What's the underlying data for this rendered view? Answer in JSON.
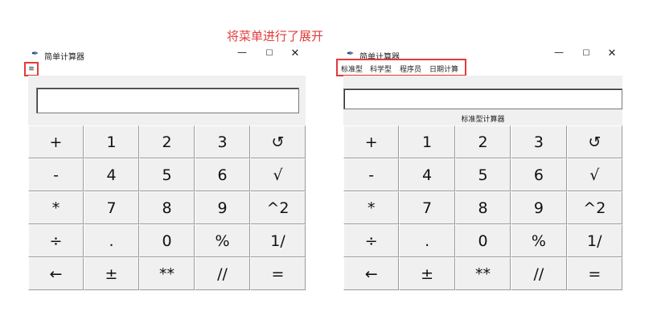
{
  "annotation": "将菜单进行了展开",
  "left_window": {
    "title": "简单计算器",
    "menu_toggle_label": "≡",
    "display_value": "",
    "keys": [
      "+",
      "1",
      "2",
      "3",
      "↺",
      "-",
      "4",
      "5",
      "6",
      "√",
      "*",
      "7",
      "8",
      "9",
      "^2",
      "÷",
      ".",
      "0",
      "%",
      "1/",
      "←",
      "±",
      "**",
      "//",
      "="
    ]
  },
  "right_window": {
    "title": "简单计算器",
    "menu_items": [
      "标准型",
      "科学型",
      "程序员",
      "日期计算"
    ],
    "display_value": "",
    "subtitle": "标准型计算器",
    "keys": [
      "+",
      "1",
      "2",
      "3",
      "↺",
      "-",
      "4",
      "5",
      "6",
      "√",
      "*",
      "7",
      "8",
      "9",
      "^2",
      "÷",
      ".",
      "0",
      "%",
      "1/",
      "←",
      "±",
      "**",
      "//",
      "="
    ]
  },
  "window_controls": {
    "minimize": "—",
    "maximize": "☐",
    "close": "✕"
  },
  "icons": {
    "app": "feather-icon",
    "highlight_color": "#e23a3a",
    "annotation_color": "#e03b3b"
  }
}
